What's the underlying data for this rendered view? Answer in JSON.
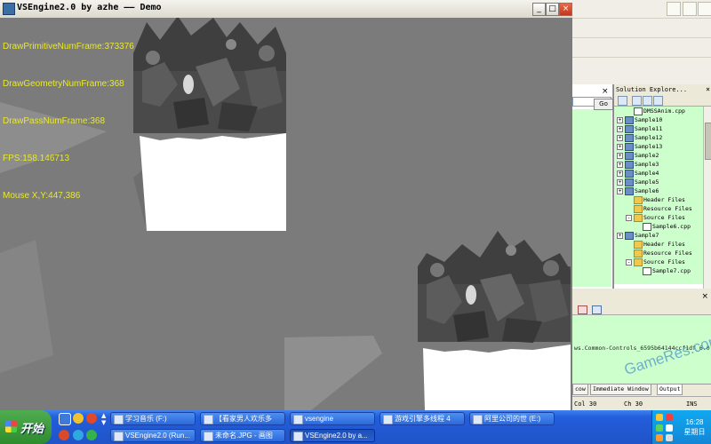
{
  "window": {
    "title": "VSEngine2.0 by azhe —— Demo",
    "minimize_label": "_",
    "maximize_label": "□",
    "close_label": "×"
  },
  "hud": {
    "lines": [
      "DrawPrimitiveNumFrame:373376",
      "DrawGeometryNumFrame:368",
      "DrawPassNumFrame:368",
      "FPS:158.146713",
      "Mouse X,Y:447,386"
    ]
  },
  "ide": {
    "go_button": "Go",
    "solution_explorer": {
      "title": "Solution Explore...",
      "close": "×",
      "items": [
        {
          "label": "DMSSAnim.cpp",
          "kind": "file",
          "indent": 2
        },
        {
          "label": "Sample10",
          "kind": "project",
          "indent": 1
        },
        {
          "label": "Sample11",
          "kind": "project",
          "indent": 1
        },
        {
          "label": "Sample12",
          "kind": "project",
          "indent": 1
        },
        {
          "label": "Sample13",
          "kind": "project",
          "indent": 1
        },
        {
          "label": "Sample2",
          "kind": "project",
          "indent": 1
        },
        {
          "label": "Sample3",
          "kind": "project",
          "indent": 1
        },
        {
          "label": "Sample4",
          "kind": "project",
          "indent": 1
        },
        {
          "label": "Sample5",
          "kind": "project",
          "indent": 1
        },
        {
          "label": "Sample6",
          "kind": "project",
          "indent": 1
        },
        {
          "label": "Header Files",
          "kind": "folder",
          "indent": 2
        },
        {
          "label": "Resource Files",
          "kind": "folder",
          "indent": 2
        },
        {
          "label": "Source Files",
          "kind": "folder",
          "indent": 2
        },
        {
          "label": "Sample6.cpp",
          "kind": "file",
          "indent": 3
        },
        {
          "label": "Sample7",
          "kind": "project",
          "indent": 1
        },
        {
          "label": "Header Files",
          "kind": "folder",
          "indent": 2
        },
        {
          "label": "Resource Files",
          "kind": "folder",
          "indent": 2
        },
        {
          "label": "Source Files",
          "kind": "folder",
          "indent": 2
        },
        {
          "label": "Sample7.cpp",
          "kind": "file",
          "indent": 3
        }
      ]
    },
    "output": {
      "close": "×",
      "text": "ws.Common-Controls_6595b64144ccf1df_6.0",
      "tabs": [
        "cow",
        "Immediate Window",
        "Output"
      ],
      "active_tab": "Output"
    },
    "status": {
      "col": "Col 30",
      "ch": "Ch 30",
      "ins": "INS"
    }
  },
  "watermark": "GameRes.com",
  "taskbar": {
    "start_label": "开始",
    "row1": [
      {
        "label": "学习音乐 (F:)"
      },
      {
        "label": "【看家男人欢乐多"
      },
      {
        "label": "vsengine"
      },
      {
        "label": "游戏引擎多线程 4"
      },
      {
        "label": "阿里公司的世 (E:)"
      }
    ],
    "row2": [
      {
        "label": "VSEngine2.0 (Run..."
      },
      {
        "label": "未命名.JPG - 画图"
      },
      {
        "label": "VSEngine2.0 by a..."
      }
    ],
    "active_task": "VSEngine2.0 by a...",
    "clock_time": "16:28",
    "clock_day": "星期日"
  },
  "colors": {
    "hud_text": "#e8e830",
    "viewport_bg": "#7b7b7b",
    "tree_bg": "#ccffcc",
    "taskbar": "#245edb"
  }
}
